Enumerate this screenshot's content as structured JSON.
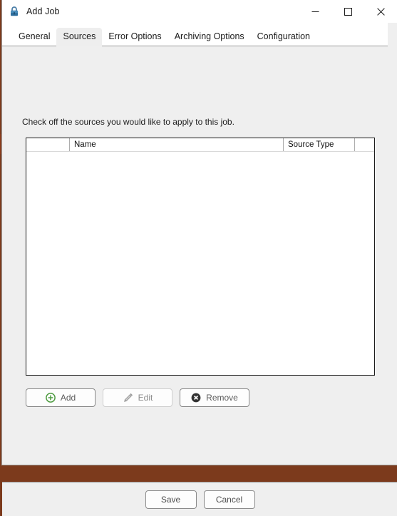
{
  "window": {
    "title": "Add Job",
    "icon": "padlock-icon",
    "controls": {
      "minimize": "Minimize",
      "maximize": "Maximize",
      "close": "Close"
    }
  },
  "tabs": [
    {
      "label": "General",
      "selected": false
    },
    {
      "label": "Sources",
      "selected": true
    },
    {
      "label": "Error Options",
      "selected": false
    },
    {
      "label": "Archiving Options",
      "selected": false
    },
    {
      "label": "Configuration",
      "selected": false
    }
  ],
  "main": {
    "instruction": "Check off the sources you would like to apply to this job.",
    "list": {
      "columns": [
        {
          "label": "",
          "name": "checkbox-column"
        },
        {
          "label": "Name",
          "name": "name-column"
        },
        {
          "label": "Source Type",
          "name": "source-type-column"
        },
        {
          "label": "",
          "name": "extra-column"
        }
      ],
      "rows": []
    },
    "actions": [
      {
        "label": "Add",
        "icon": "plus-circle-icon",
        "enabled": true,
        "accent": "#4c9a3f"
      },
      {
        "label": "Edit",
        "icon": "pencil-icon",
        "enabled": false,
        "accent": "#9a9a9a"
      },
      {
        "label": "Remove",
        "icon": "x-circle-icon",
        "enabled": true,
        "accent": "#333333"
      }
    ]
  },
  "footer": {
    "save_label": "Save",
    "cancel_label": "Cancel"
  },
  "colors": {
    "dialog_background": "#efefef",
    "titlebar_background": "#ffffff",
    "list_border": "#1a1a1a",
    "accent_add": "#4c9a3f",
    "accent_remove": "#333333",
    "behind_window_sliver": "#8a3b1b"
  }
}
